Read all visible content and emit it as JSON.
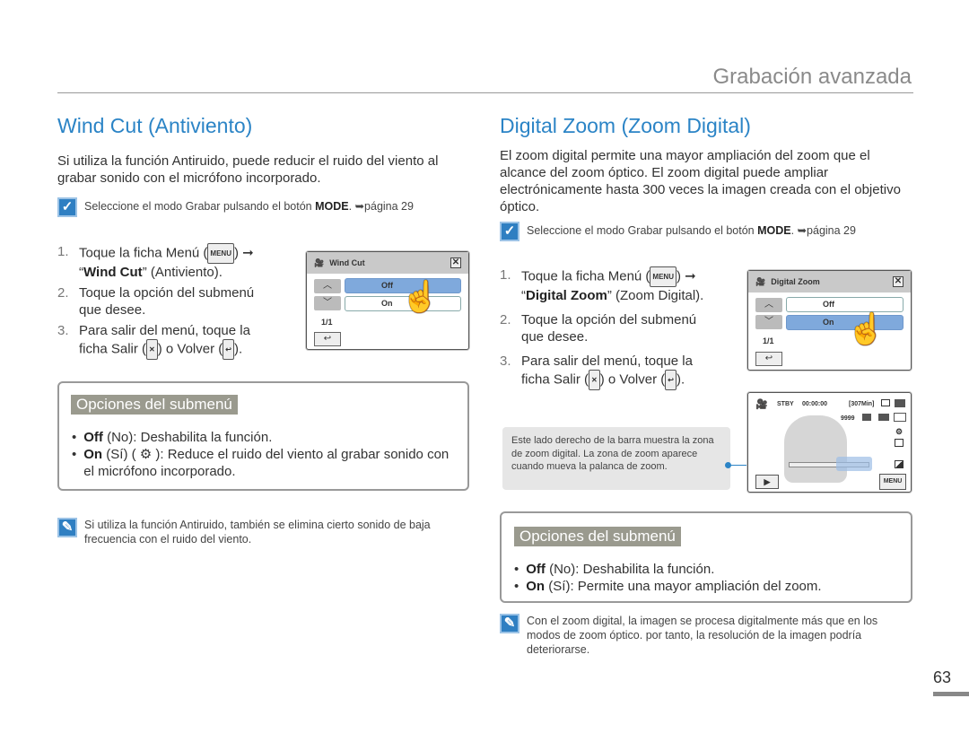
{
  "header": {
    "chapter": "Grabación avanzada"
  },
  "page_number": "63",
  "left": {
    "title": "Wind Cut (Antiviento)",
    "intro": "Si utiliza la función Antiruido, puede reducir el ruido del viento al grabar sonido con el micrófono incorporado.",
    "precheck": {
      "text": "Seleccione el modo Grabar pulsando el botón ",
      "key": "MODE",
      "suffix": ". ➥página 29"
    },
    "steps": [
      {
        "n": "1.",
        "a": "Toque la ficha Menú (",
        "key": "MENU",
        "b": ") ➞ “",
        "bold": "Wind Cut",
        "c": "” (Antiviento)."
      },
      {
        "n": "2.",
        "text": "Toque la opción del submenú que desee."
      },
      {
        "n": "3.",
        "a": "Para salir del menú, toque la ficha Salir (",
        "b": ") o Volver (",
        "c": ")."
      }
    ],
    "screen": {
      "title": "Wind Cut",
      "options": [
        "Off",
        "On"
      ],
      "page": "1/1"
    },
    "submenu": {
      "heading": "Opciones del submenú",
      "items": [
        {
          "bold": "Off",
          "rest": " (No): Deshabilita la función."
        },
        {
          "bold": "On",
          "rest": " (Sí) ( ⚙ ): Reduce el ruido del viento al grabar sonido con el micrófono incorporado."
        }
      ]
    },
    "note": "Si utiliza la función Antiruido, también se elimina cierto sonido de baja frecuencia con el ruido del viento."
  },
  "right": {
    "title": "Digital Zoom (Zoom Digital)",
    "intro": "El zoom digital permite una mayor ampliación del zoom que el alcance del zoom óptico. El zoom digital puede ampliar electrónicamente hasta 300 veces la imagen creada con el objetivo óptico.",
    "precheck": {
      "text": "Seleccione el modo Grabar pulsando el botón ",
      "key": "MODE",
      "suffix": ". ➥página 29"
    },
    "steps": [
      {
        "n": "1.",
        "a": "Toque la ficha Menú (",
        "key": "MENU",
        "b": ") ➞ “",
        "bold": "Digital Zoom",
        "c": "” (Zoom Digital)."
      },
      {
        "n": "2.",
        "text": "Toque la opción del submenú que desee."
      },
      {
        "n": "3.",
        "a": "Para salir del menú, toque la ficha Salir (",
        "b": ") o Volver (",
        "c": ")."
      }
    ],
    "screen": {
      "title": "Digital Zoom",
      "options": [
        "Off",
        "On"
      ],
      "page": "1/1"
    },
    "callout": "Este lado derecho de la barra muestra la zona de zoom digital. La zona de zoom aparece cuando mueva la palanca de zoom.",
    "viewfinder": {
      "status": "STBY",
      "time": "00:00:00",
      "remaining": "[307Min]",
      "count": "9999",
      "menu": "MENU"
    },
    "submenu": {
      "heading": "Opciones del submenú",
      "items": [
        {
          "bold": "Off",
          "rest": " (No): Deshabilita la función."
        },
        {
          "bold": "On",
          "rest": " (Sí): Permite una mayor ampliación del zoom."
        }
      ]
    },
    "note": "Con el zoom digital, la imagen se procesa digitalmente más que en los modos de zoom óptico. por tanto, la resolución de la imagen podría deteriorarse."
  }
}
